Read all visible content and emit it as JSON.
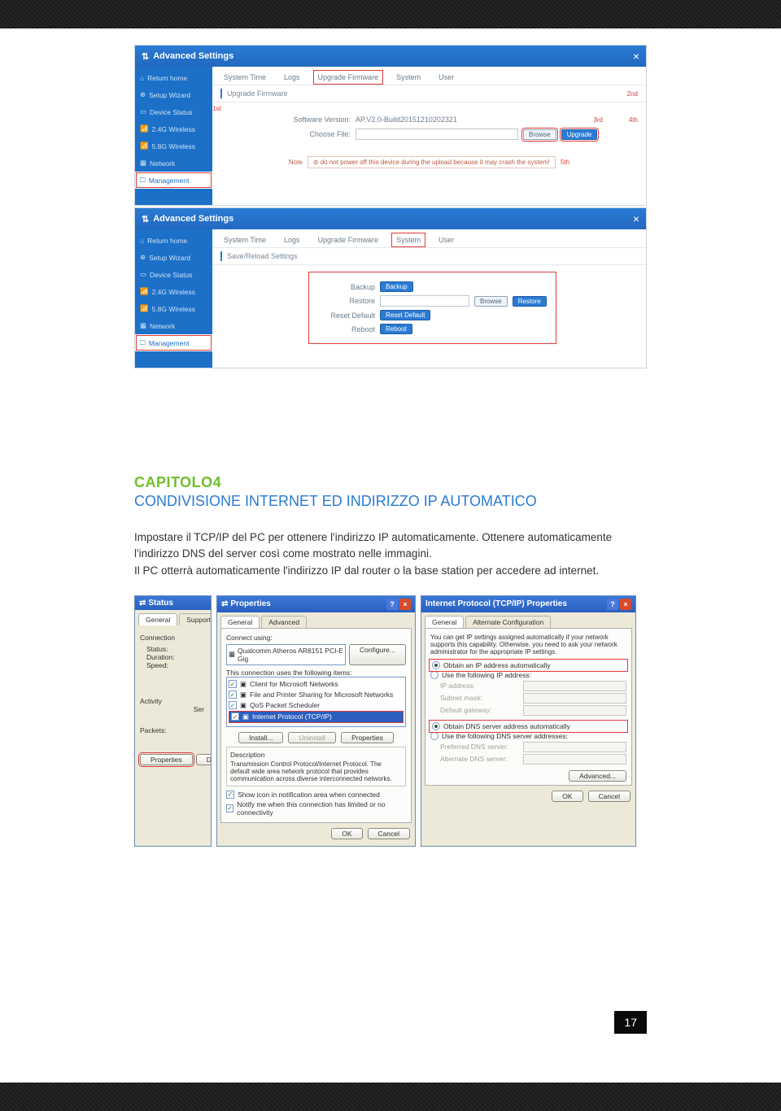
{
  "topbar": {},
  "panel1": {
    "title": "Advanced Settings",
    "side": [
      "Return home",
      "Setup Wizard",
      "Device Status",
      "2.4G Wireless",
      "5.8G Wireless",
      "Network",
      "Management"
    ],
    "side_ann": "1st",
    "tabs": [
      "System Time",
      "Logs",
      "Upgrade Firmware",
      "System",
      "User"
    ],
    "ann2": "2nd",
    "sub": "Upgrade Firmware",
    "sw_label": "Software Version:",
    "sw_value": "AP.V2.0-Build20151210202321",
    "ann3": "3rd",
    "ann4": "4th",
    "file_label": "Choose File:",
    "browse": "Browse",
    "upgrade": "Upgrade",
    "note_key": "Note",
    "note_text": "do not power off this device during the upload because it may crash the system!",
    "ann5": "5th"
  },
  "panel2": {
    "title": "Advanced Settings",
    "side": [
      "Return home",
      "Setup Wizard",
      "Device Status",
      "2.4G Wireless",
      "5.8G Wireless",
      "Network",
      "Management"
    ],
    "tabs": [
      "System Time",
      "Logs",
      "Upgrade Firmware",
      "System",
      "User"
    ],
    "sub": "Save/Reload Settings",
    "rows": {
      "backup_l": "Backup",
      "backup_b": "Backup",
      "restore_l": "Restore",
      "browse": "Browse",
      "restore_b": "Restore",
      "reset_l": "Reset Default",
      "reset_b": "Reset Default",
      "reboot_l": "Reboot",
      "reboot_b": "Reboot"
    }
  },
  "chapter": {
    "title": "CAPITOLO4",
    "subtitle": "CONDIVISIONE INTERNET ED INDIRIZZO IP AUTOMATICO",
    "p1": "Impostare il TCP/IP del PC per ottenere l'indirizzo IP automaticamente. Ottenere automaticamente l'indirizzo DNS del server così come mostrato nelle immagini.",
    "p2": "Il PC otterrà automaticamente l'indirizzo IP dal router o la base station per accedere ad internet."
  },
  "xp_status": {
    "title": "Status",
    "tabs": [
      "General",
      "Support"
    ],
    "group1": "Connection",
    "l1": "Status:",
    "l2": "Duration:",
    "l3": "Speed:",
    "group2": "Activity",
    "sent": "Ser",
    "l4": "Packets:",
    "btn_prop": "Properties",
    "btn_dis": "Disab"
  },
  "xp_props": {
    "title": "Properties",
    "tabs": [
      "General",
      "Advanced"
    ],
    "connect_label": "Connect using:",
    "adapter": "Qualcomm Atheros AR8151 PCI-E Gig",
    "configure": "Configure...",
    "uses": "This connection uses the following items:",
    "items": [
      "Client for Microsoft Networks",
      "File and Printer Sharing for Microsoft Networks",
      "QoS Packet Scheduler",
      "Internet Protocol (TCP/IP)"
    ],
    "install": "Install...",
    "uninstall": "Uninstall",
    "properties": "Properties",
    "desc_h": "Description",
    "desc": "Transmission Control Protocol/Internet Protocol. The default wide area network protocol that provides communication across diverse interconnected networks.",
    "chk1": "Show icon in notification area when connected",
    "chk2": "Notify me when this connection has limited or no connectivity",
    "ok": "OK",
    "cancel": "Cancel"
  },
  "xp_ip": {
    "title": "Internet Protocol (TCP/IP) Properties",
    "tabs": [
      "General",
      "Alternate Configuration"
    ],
    "blurb": "You can get IP settings assigned automatically if your network supports this capability. Otherwise, you need to ask your network administrator for the appropriate IP settings.",
    "r1": "Obtain an IP address automatically",
    "r2": "Use the following IP address:",
    "f1": "IP address:",
    "f2": "Subnet mask:",
    "f3": "Default gateway:",
    "r3": "Obtain DNS server address automatically",
    "r4": "Use the following DNS server addresses:",
    "f4": "Preferred DNS server:",
    "f5": "Alternate DNS server:",
    "adv": "Advanced...",
    "ok": "OK",
    "cancel": "Cancel"
  },
  "page_number": "17"
}
